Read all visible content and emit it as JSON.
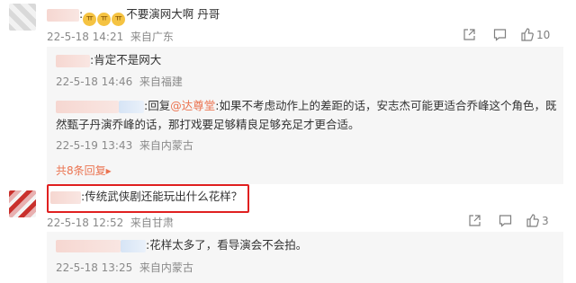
{
  "comments": [
    {
      "prefix_colon": ":",
      "emoji_count": 3,
      "text": "不要演网大啊 丹哥",
      "time": "22-5-18 14:21",
      "location": "来自广东",
      "likes": "10",
      "replies": [
        {
          "text": ":肯定不是网大",
          "time": "22-5-18 14:46",
          "location": "来自福建"
        },
        {
          "reply_prefix": ":回复",
          "mention": "@达尊堂",
          "text_line1": ":如果不考虑动作上的差距的话，安志杰可能更适合乔峰这个角色，既",
          "text_line2": "然甄子丹演乔峰的话，那打戏要足够精良足够充足才更合适。",
          "time": "22-5-19 13:43",
          "location": "来自内蒙古"
        }
      ],
      "more_replies": "共8条回复",
      "more_arrow": "▸"
    },
    {
      "text": ":传统武侠剧还能玩出什么花样？",
      "time": "22-5-18 12:52",
      "location": "来自甘肃",
      "likes": "3",
      "replies": [
        {
          "text": ":花样太多了，看导演会不会拍。",
          "time": "22-5-18 13:25",
          "location": "来自内蒙古"
        }
      ]
    }
  ],
  "colors": {
    "accent": "#eb7350",
    "highlight": "#e02020",
    "meta": "#8a8a8a"
  },
  "icons": [
    "share-icon",
    "comment-icon",
    "like-icon"
  ]
}
